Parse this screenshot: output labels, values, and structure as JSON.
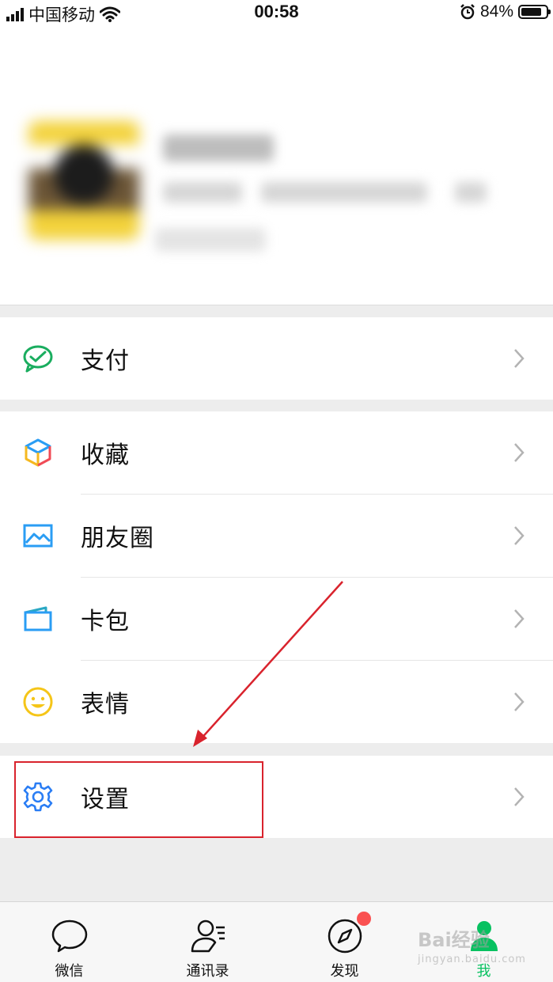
{
  "status": {
    "carrier": "中国移动",
    "time": "00:58",
    "battery": "84%",
    "battery_level": 0.84
  },
  "menu": {
    "pay": "支付",
    "favorites": "收藏",
    "moments": "朋友圈",
    "cards": "卡包",
    "stickers": "表情",
    "settings": "设置"
  },
  "tabs": [
    {
      "label": "微信",
      "icon": "chat-icon"
    },
    {
      "label": "通讯录",
      "icon": "contacts-icon"
    },
    {
      "label": "发现",
      "icon": "compass-icon"
    },
    {
      "label": "我",
      "icon": "me-icon"
    }
  ],
  "watermark": {
    "text": "Bai经验",
    "sub": "jingyan.baidu.com"
  },
  "colors": {
    "accent": "#07c160",
    "badge": "#fa5151",
    "highlight": "#d9232d"
  }
}
